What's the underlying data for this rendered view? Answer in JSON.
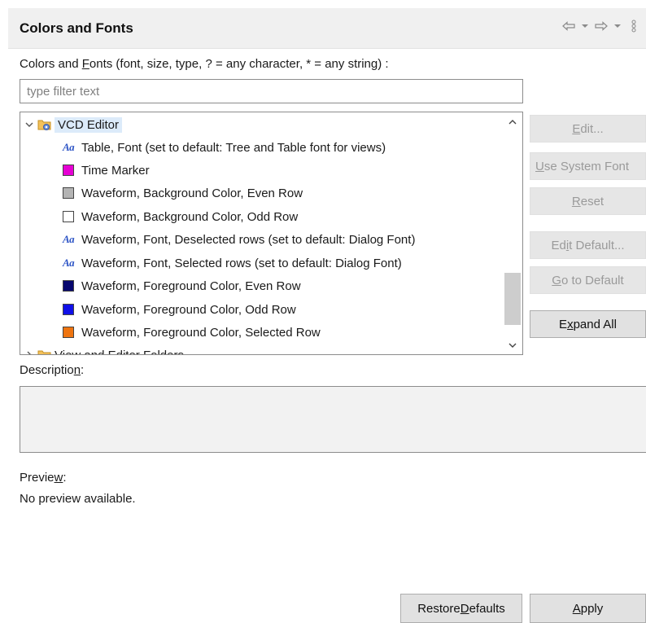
{
  "header": {
    "title": "Colors and Fonts",
    "nav_icons": [
      "back-arrow-icon",
      "chevron-down-icon",
      "forward-arrow-icon",
      "chevron-down-icon",
      "view-menu-icon"
    ]
  },
  "filter": {
    "label_pre": "Colors and ",
    "label_mnemonic": "F",
    "label_post": "onts (font, size, type, ? = any character, * = any string) :",
    "placeholder": "type filter text",
    "value": ""
  },
  "tree": {
    "root": {
      "label": "VCD Editor",
      "expanded": true,
      "selected": true
    },
    "items": [
      {
        "type": "font",
        "icon": "font-icon",
        "label": "Table, Font (set to default: Tree and Table font for views)"
      },
      {
        "type": "color",
        "color": "#e600d4",
        "label": "Time Marker"
      },
      {
        "type": "color",
        "color": "#b4b4b4",
        "label": "Waveform, Background Color, Even Row"
      },
      {
        "type": "color",
        "color": "#ffffff",
        "label": "Waveform, Background Color, Odd Row"
      },
      {
        "type": "font",
        "icon": "font-icon",
        "label": "Waveform, Font, Deselected rows (set to default: Dialog Font)"
      },
      {
        "type": "font",
        "icon": "font-icon",
        "label": "Waveform, Font, Selected rows (set to default: Dialog Font)"
      },
      {
        "type": "color",
        "color": "#06066e",
        "label": "Waveform, Foreground Color, Even Row"
      },
      {
        "type": "color",
        "color": "#1010e8",
        "label": "Waveform, Foreground Color, Odd Row"
      },
      {
        "type": "color",
        "color": "#ee7410",
        "label": "Waveform, Foreground Color, Selected Row"
      }
    ],
    "next_root": {
      "label": "View and Editor Folders",
      "expanded": false
    }
  },
  "buttons": {
    "edit": {
      "pre": "",
      "mnemonic": "E",
      "post": "dit...",
      "enabled": false
    },
    "use_system_font": {
      "pre": "",
      "mnemonic": "U",
      "post": "se System Font",
      "enabled": false
    },
    "reset": {
      "pre": "",
      "mnemonic": "R",
      "post": "eset",
      "enabled": false
    },
    "edit_default": {
      "pre": "Ed",
      "mnemonic": "i",
      "post": "t Default...",
      "enabled": false
    },
    "go_to_default": {
      "pre": "",
      "mnemonic": "G",
      "post": "o to Default",
      "enabled": false
    },
    "expand_all": {
      "pre": "E",
      "mnemonic": "x",
      "post": "pand All",
      "enabled": true
    }
  },
  "description": {
    "pre": "Descriptio",
    "mnemonic": "n",
    "post": ":",
    "value": ""
  },
  "preview": {
    "pre": "Previe",
    "mnemonic": "w",
    "post": ":",
    "text": "No preview available."
  },
  "footer": {
    "restore_defaults": {
      "pre": "Restore ",
      "mnemonic": "D",
      "post": "efaults"
    },
    "apply": {
      "pre": "",
      "mnemonic": "A",
      "post": "pply"
    }
  }
}
